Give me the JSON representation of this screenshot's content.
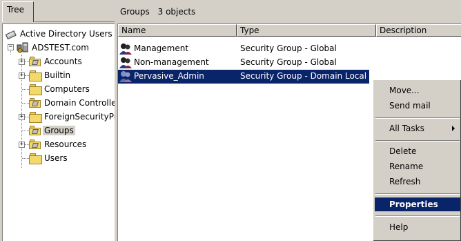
{
  "tree_tab": {
    "label": "Tree"
  },
  "list_header": {
    "title": "Groups",
    "count": "3 objects"
  },
  "tree": {
    "items": [
      {
        "label": "Active Directory Users and Computers",
        "icon": "ad-snapin-icon"
      },
      {
        "label": "ADSTEST.com",
        "icon": "domain-icon"
      },
      {
        "label": "Accounts",
        "icon": "ou-icon"
      },
      {
        "label": "Builtin",
        "icon": "folder-icon"
      },
      {
        "label": "Computers",
        "icon": "folder-icon"
      },
      {
        "label": "Domain Controllers",
        "icon": "ou-icon"
      },
      {
        "label": "ForeignSecurityPrincipals",
        "icon": "folder-icon"
      },
      {
        "label": "Groups",
        "icon": "ou-icon",
        "selected": true
      },
      {
        "label": "Resources",
        "icon": "ou-icon"
      },
      {
        "label": "Users",
        "icon": "folder-icon"
      }
    ]
  },
  "columns": {
    "name": "Name",
    "type": "Type",
    "description": "Description"
  },
  "rows": [
    {
      "name": "Management",
      "type": "Security Group - Global",
      "description": ""
    },
    {
      "name": "Non-management",
      "type": "Security Group - Global",
      "description": ""
    },
    {
      "name": "Pervasive_Admin",
      "type": "Security Group - Domain Local",
      "description": "",
      "selected": true
    }
  ],
  "context_menu": {
    "items": [
      {
        "label": "Move..."
      },
      {
        "label": "Send mail"
      },
      {
        "label": "All Tasks",
        "submenu": true
      },
      {
        "label": "Delete"
      },
      {
        "label": "Rename"
      },
      {
        "label": "Refresh"
      },
      {
        "label": "Properties",
        "highlighted": true
      },
      {
        "label": "Help"
      }
    ]
  },
  "colors": {
    "face": "#d4d0c8",
    "selection": "#0a246a",
    "window": "#ffffff"
  }
}
